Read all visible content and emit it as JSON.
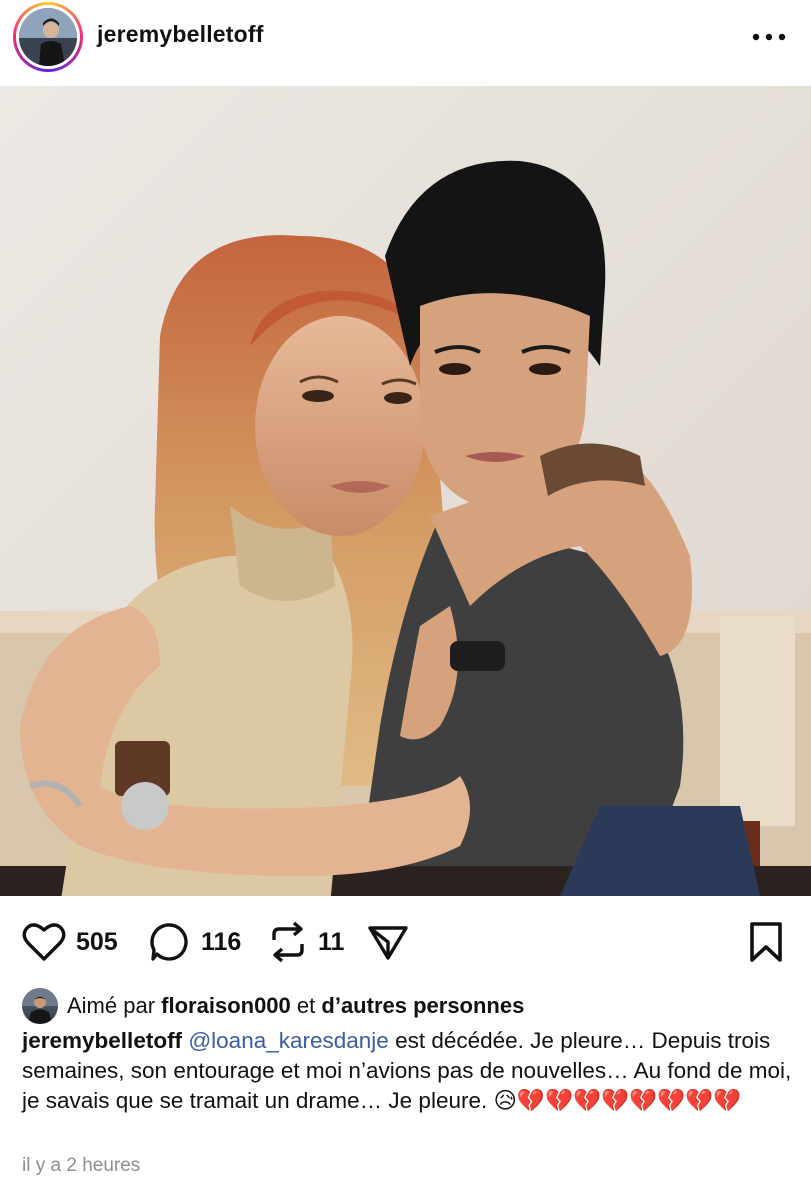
{
  "post": {
    "username": "jeremybelletoff",
    "more_icon": "•••"
  },
  "actions": {
    "likes": "505",
    "comments": "116",
    "reposts": "11"
  },
  "liked_by": {
    "prefix": "Aimé par",
    "user": "floraison000",
    "middle": "et",
    "others": "d’autres personnes"
  },
  "caption": {
    "username": "jeremybelletoff",
    "mention": "@loana_karesdanje",
    "text": "est décédée. Je pleure… Depuis trois semaines, son entourage et moi n’avions pas de nouvelles… Au fond de moi, je savais que se tramait un drame… Je pleure. 😥💔💔💔💔💔💔💔💔"
  },
  "timestamp": "il y a 2 heures",
  "colors": {
    "text": "#111111",
    "mention": "#3b5ba5",
    "muted": "#8e8e8e"
  }
}
